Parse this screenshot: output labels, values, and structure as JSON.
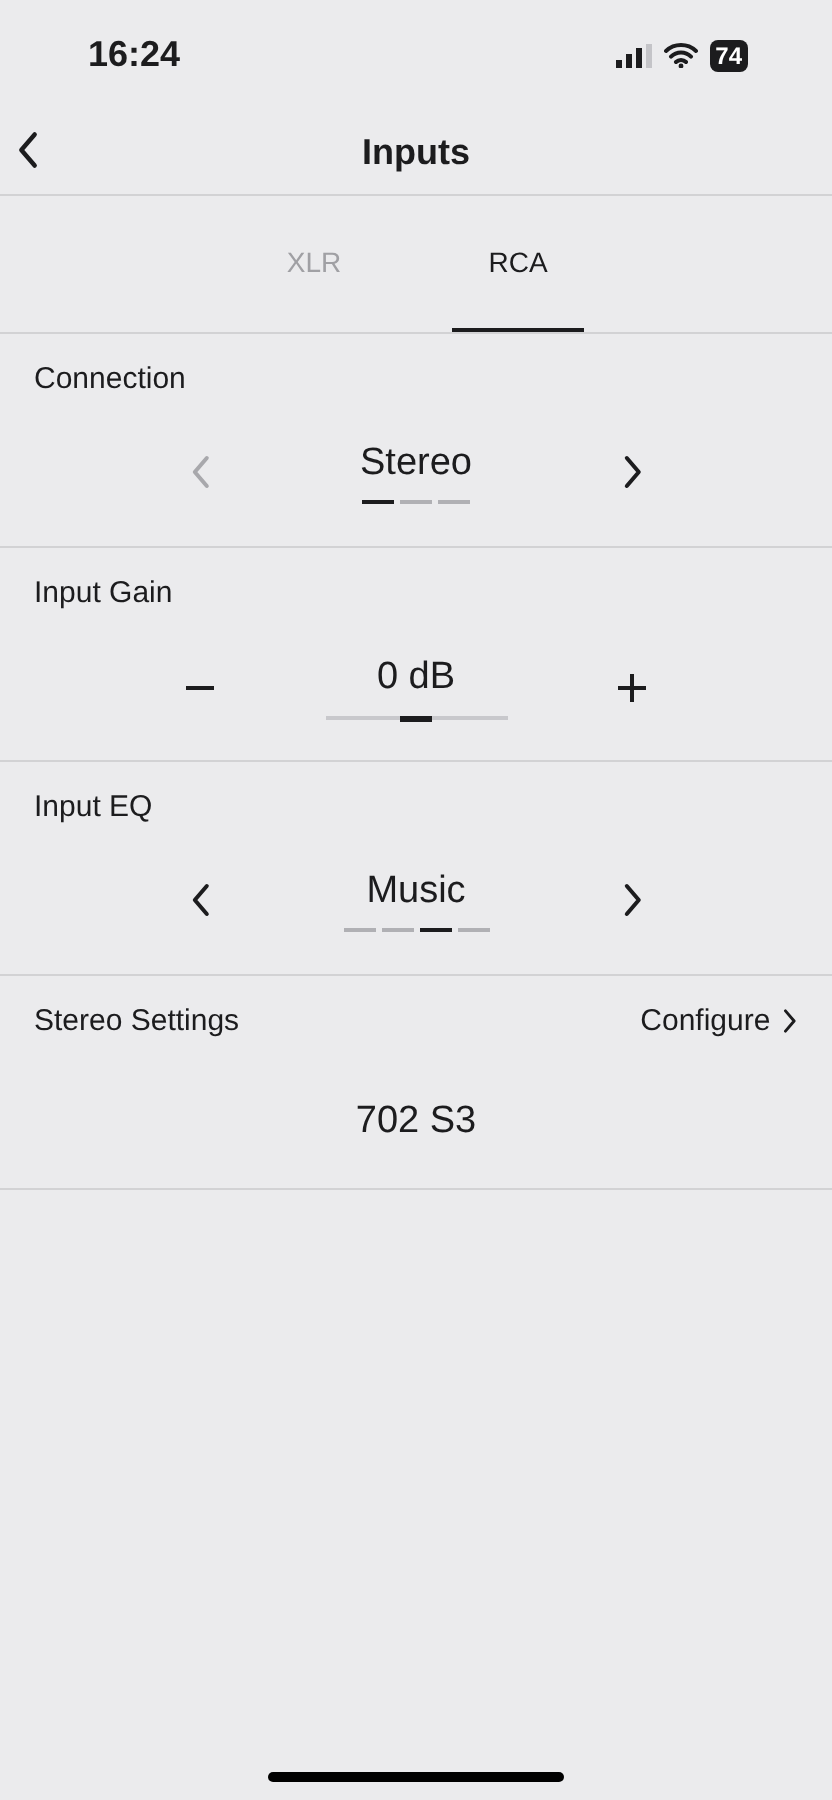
{
  "status_bar": {
    "time": "16:24",
    "battery": "74"
  },
  "nav": {
    "title": "Inputs"
  },
  "tabs": [
    {
      "label": "XLR",
      "selected": false
    },
    {
      "label": "RCA",
      "selected": true
    }
  ],
  "sections": [
    {
      "kind": "selector",
      "label": "Connection",
      "value": "Stereo",
      "prev_disabled": true,
      "steps": [
        {
          "selected": true
        },
        {
          "selected": false
        },
        {
          "selected": false
        }
      ]
    },
    {
      "kind": "stepper",
      "label": "Input Gain",
      "value": "0 dB",
      "level": 0.5
    },
    {
      "kind": "selector",
      "label": "Input EQ",
      "value": "Music",
      "prev_disabled": false,
      "steps": [
        {
          "selected": false
        },
        {
          "selected": false
        },
        {
          "selected": true
        },
        {
          "selected": false
        }
      ]
    },
    {
      "kind": "link",
      "label": "Stereo Settings",
      "action": "Configure",
      "value": "702 S3"
    }
  ]
}
